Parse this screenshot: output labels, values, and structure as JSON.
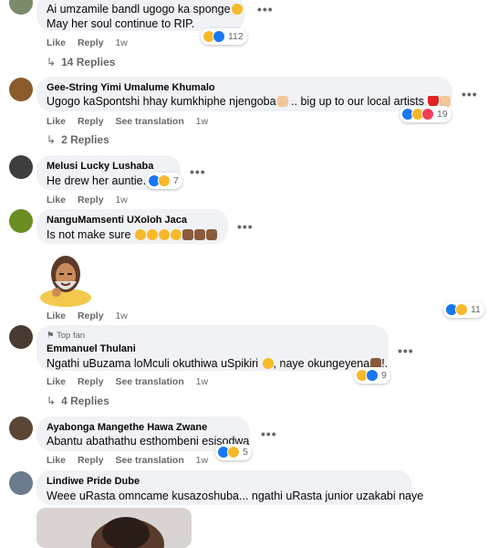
{
  "comments": [
    {
      "name": "",
      "text_lines": [
        "Ai umzamile bandl ugogo ka sponge",
        "May her soul continue to RIP."
      ],
      "actions": [
        "Like",
        "Reply"
      ],
      "time": "1w",
      "reaction_count": "112",
      "replies_label": "14 Replies"
    },
    {
      "name": "Gee-String Yimi Umalume Khumalo",
      "text": "Ugogo kaSpontshi hhay kumkhiphe njengoba",
      "text_tail": ".. big up to our local artists",
      "actions": [
        "Like",
        "Reply",
        "See translation"
      ],
      "time": "1w",
      "reaction_count": "19",
      "replies_label": "2 Replies"
    },
    {
      "name": "Melusi Lucky Lushaba",
      "text": "He drew her auntie.",
      "actions": [
        "Like",
        "Reply"
      ],
      "time": "1w",
      "reaction_count": "7"
    },
    {
      "name": "NanguMamsenti UXoloh Jaca",
      "text": "Is not make sure",
      "actions": [
        "Like",
        "Reply"
      ],
      "time": "1w",
      "reaction_count": "11"
    },
    {
      "badge": "Top fan",
      "name": "Emmanuel Thulani",
      "text": "Ngathi uBuzama loMculi okuthiwa uSpikiri",
      "text_tail": ", naye okungeyena",
      "text_end": "!.",
      "actions": [
        "Like",
        "Reply",
        "See translation"
      ],
      "time": "1w",
      "reaction_count": "9",
      "replies_label": "4 Replies"
    },
    {
      "name": "Ayabonga Mangethe Hawa Zwane",
      "text": "Abantu abathathu esthombeni esisodwa",
      "actions": [
        "Like",
        "Reply",
        "See translation"
      ],
      "time": "1w",
      "reaction_count": "5"
    },
    {
      "name": "Lindiwe Pride Dube",
      "text": "Weee uRasta omncame kusazoshuba... ngathi uRasta junior uzakabi naye"
    }
  ],
  "colors": {
    "bubble": "#f0f2f5",
    "meta": "#65676b",
    "like": "#1877f2",
    "haha": "#f7b928",
    "love": "#f33e58"
  },
  "icons": {
    "more": "more-horizontal-icon",
    "reply_arrow": "reply-arrow-icon",
    "top_fan": "top-fan-badge-icon"
  }
}
